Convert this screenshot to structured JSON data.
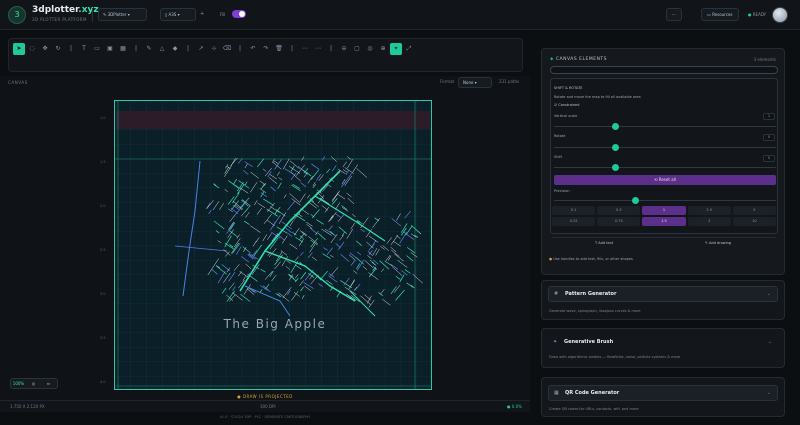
{
  "header": {
    "logo_letter": "3",
    "brand_a": "3dplotter",
    "brand_b": ".xyz",
    "subtitle": "3D PLOTTER PLATFORM",
    "pen_select": "3DPlotter",
    "paper_select": "A3S",
    "toggle_label": "Fill",
    "more_btn": "···",
    "resources": "Resources",
    "ready": "READY"
  },
  "canvas": {
    "label": "CANVAS",
    "format_label": "Format",
    "format_value": "None",
    "count": "231 paths",
    "map_caption": "The Big Apple",
    "hint": "● DRAW IS PROJECTED",
    "zoom": "100%",
    "tick_left": [
      "1.0",
      "1.5",
      "2.0",
      "2.5",
      "3.0",
      "3.5",
      "4.0"
    ]
  },
  "status": {
    "left": "1,750 X 2,120 PX",
    "mid": "300 DPI",
    "right": "● 0.0%"
  },
  "footer": "v1.0 · ©2024 3DP · PLC · GENERATE CARTOGRAPHY",
  "panel": {
    "title": "CANVAS ELEMENTS",
    "title_right": "3 elements",
    "sec": "SHIFT & ROTATE",
    "sec_desc": "Rotate and move the map to fill all available area",
    "toggle": "Constrained",
    "rows": [
      {
        "label": "Vertical scale",
        "val": "1"
      },
      {
        "label": "Rotate",
        "val": "0"
      },
      {
        "label": "Shift",
        "val": "0"
      }
    ],
    "reset": "Reset all",
    "precision": "Precision",
    "grid": [
      "0.1",
      "0.5",
      "1",
      "2.5",
      "5",
      "0.25",
      "0.75",
      "1.5",
      "3",
      "10"
    ],
    "add_text": "Add text",
    "add_drawing": "Add drawing",
    "note": "Use handles to add text, fills, or other shapes"
  },
  "cards": [
    {
      "icon": "#",
      "title": "Pattern Generator",
      "desc": "Generate wave, spirograph, lissajous curves & more"
    },
    {
      "icon": "✦",
      "title": "Generative Brush",
      "desc": "Draw with algorithmic strokes — flowfields, noise, particle systems & more"
    },
    {
      "icon": "▦",
      "title": "QR Code Generator",
      "desc": "Create QR codes for URLs, contacts, wifi, and more"
    }
  ],
  "colors": {
    "accent": "#1fc99a",
    "purple": "#7e3fd0"
  }
}
